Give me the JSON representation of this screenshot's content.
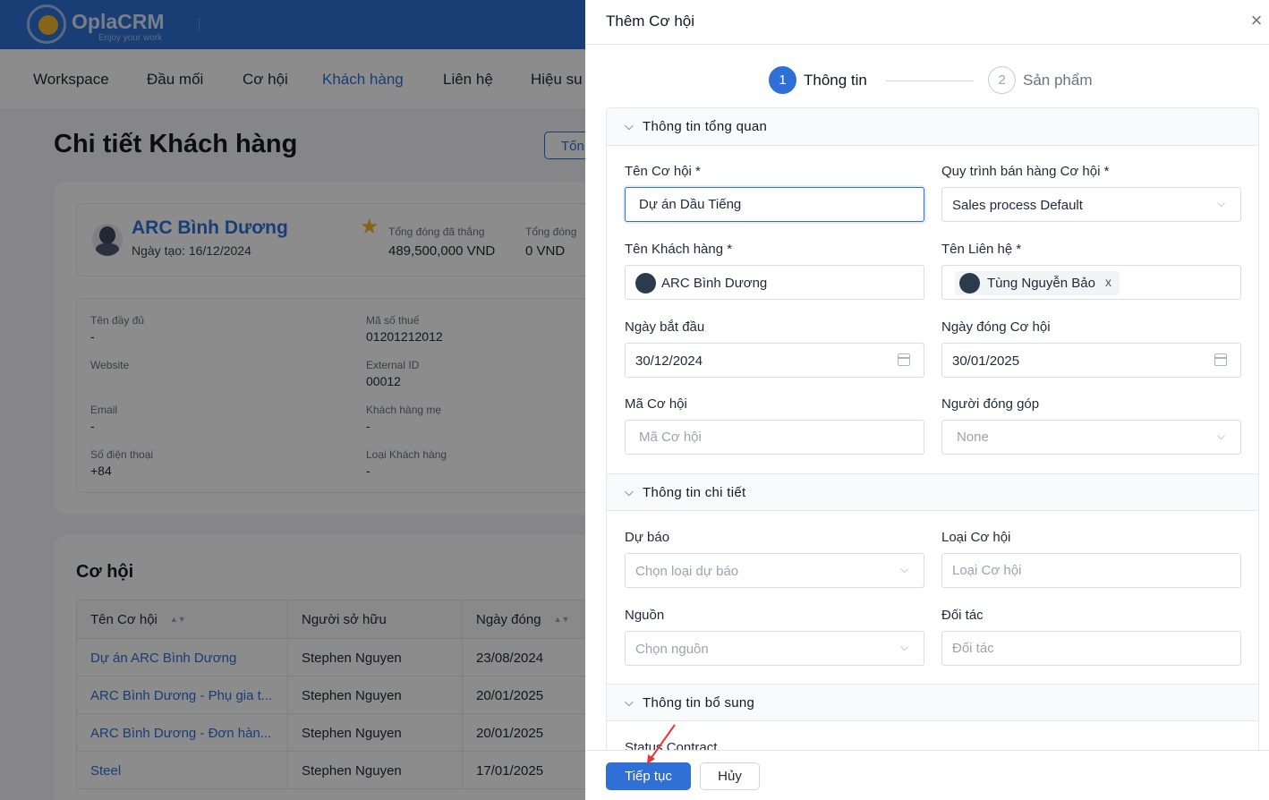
{
  "app": {
    "logo_name": "OplaCRM",
    "logo_tagline": "Enjoy your work",
    "nav": [
      "Workspace",
      "Đầu mối",
      "Cơ hội",
      "Khách hàng",
      "Liên hệ",
      "Hiệu su"
    ],
    "active_nav": "Khách hàng",
    "page_title": "Chi tiết Khách hàng",
    "top_button": "Tốn"
  },
  "customer": {
    "name": "ARC Bình Dương",
    "created": "Ngày tạo: 16/12/2024",
    "stats": [
      {
        "label": "Tổng đóng đã thắng",
        "value": "489,500,000 VND"
      },
      {
        "label": "Tổng đóng",
        "value": "0 VND"
      }
    ],
    "details": [
      {
        "label": "Tên đầy đủ",
        "value": "-"
      },
      {
        "label": "Mã số thuế",
        "value": "01201212012"
      },
      {
        "label": "Website",
        "value": ""
      },
      {
        "label": "External ID",
        "value": "00012"
      },
      {
        "label": "Email",
        "value": "-"
      },
      {
        "label": "Khách hàng mẹ",
        "value": "-"
      },
      {
        "label": "Số điện thoại",
        "value": "+84"
      },
      {
        "label": "Loại Khách hàng",
        "value": "-"
      }
    ]
  },
  "opportunities": {
    "title": "Cơ hội",
    "columns": [
      "Tên Cơ hội",
      "Người sở hữu",
      "Ngày đóng"
    ],
    "rows": [
      [
        "Dự án ARC Bình Dương",
        "Stephen Nguyen",
        "23/08/2024"
      ],
      [
        "ARC Bình Dương - Phụ gia t...",
        "Stephen Nguyen",
        "20/01/2025"
      ],
      [
        "ARC Bình Dương - Đơn hàn...",
        "Stephen Nguyen",
        "20/01/2025"
      ],
      [
        "Steel",
        "Stephen Nguyen",
        "17/01/2025"
      ]
    ]
  },
  "drawer": {
    "title": "Thêm Cơ hội",
    "steps": [
      {
        "num": "1",
        "label": "Thông tin"
      },
      {
        "num": "2",
        "label": "Sản phẩm"
      }
    ],
    "sections": {
      "overview": "Thông tin tổng quan",
      "detail": "Thông tin chi tiết",
      "extra": "Thông tin bổ sung"
    },
    "fields": {
      "opp_name": {
        "label": "Tên Cơ hội *",
        "value": "Dự án Dầu Tiếng"
      },
      "sales_process": {
        "label": "Quy trình bán hàng Cơ hội *",
        "value": "Sales process Default"
      },
      "customer": {
        "label": "Tên Khách hàng *",
        "value": "ARC Bình Dương"
      },
      "contact": {
        "label": "Tên Liên hệ *",
        "value": "Tùng Nguyễn Bảo",
        "remove": "x"
      },
      "start_date": {
        "label": "Ngày bắt đầu",
        "value": "30/12/2024"
      },
      "close_date": {
        "label": "Ngày đóng Cơ hội",
        "value": "30/01/2025"
      },
      "opp_code": {
        "label": "Mã Cơ hội",
        "placeholder": "Mã Cơ hội"
      },
      "contributor": {
        "label": "Người đóng góp",
        "value": "None"
      },
      "forecast": {
        "label": "Dự báo",
        "placeholder": "Chọn loại dự báo"
      },
      "opp_type": {
        "label": "Loại Cơ hội",
        "placeholder": "Loại Cơ hội"
      },
      "source": {
        "label": "Nguồn",
        "placeholder": "Chọn nguồn"
      },
      "partner": {
        "label": "Đối tác",
        "placeholder": "Đối tác"
      },
      "status_contract": {
        "label": "Status Contract"
      }
    },
    "buttons": {
      "continue": "Tiếp tục",
      "cancel": "Hủy"
    }
  },
  "colors": {
    "primary": "#2f6fd6",
    "annotation_arrow": "#e53935",
    "star": "#f5b82e"
  }
}
